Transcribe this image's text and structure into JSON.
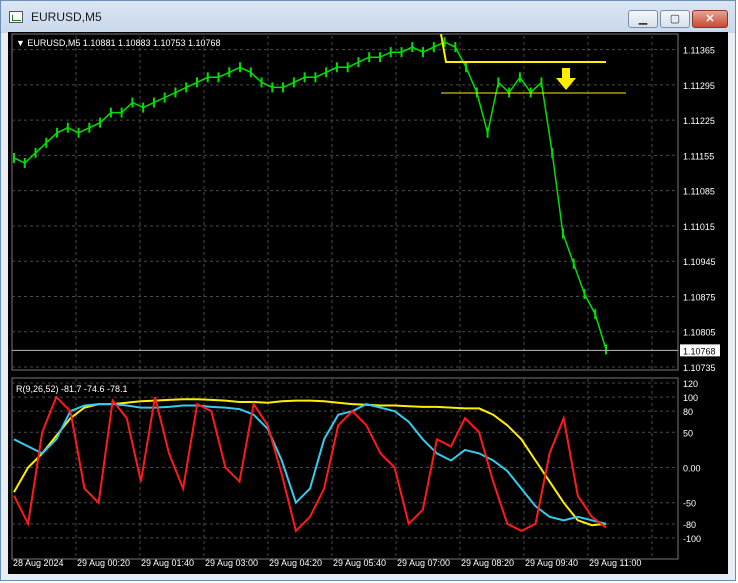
{
  "window": {
    "title": "EURUSD,M5",
    "min_glyph": "▁",
    "max_glyph": "▢",
    "close_glyph": "✕"
  },
  "header": {
    "symbol": "EURUSD,M5",
    "ohlc": "1.10881 1.10883 1.10753 1.10768"
  },
  "price_scale": {
    "labels": [
      "1.11365",
      "1.11295",
      "1.11225",
      "1.11155",
      "1.11085",
      "1.11015",
      "1.10945",
      "1.10875",
      "1.10805",
      "1.10735"
    ],
    "current": "1.10768"
  },
  "indicator": {
    "label": "R(9,26,52) -81.7 -74.6 -78.1",
    "labels": [
      "120",
      "100",
      "80",
      "50",
      "0.00",
      "-50",
      "-80",
      "-100"
    ]
  },
  "time_axis": {
    "labels": [
      "28 Aug 2024",
      "29 Aug 00:20",
      "29 Aug 01:40",
      "29 Aug 03:00",
      "29 Aug 04:20",
      "29 Aug 05:40",
      "29 Aug 07:00",
      "29 Aug 08:20",
      "29 Aug 09:40",
      "29 Aug 11:00"
    ]
  },
  "colors": {
    "bg": "#000000",
    "grid": "#4a4a4a",
    "candle": "#00e000",
    "yellow": "#ffee00",
    "red": "#ff1a1a",
    "cyan": "#33ccee",
    "text": "#ffffff"
  },
  "chart_data": {
    "type": "line",
    "price": {
      "ylim": [
        1.10735,
        1.114
      ],
      "series": [
        {
          "values": [
            1.1115,
            1.1114,
            1.1116,
            1.1118,
            1.112,
            1.1121,
            1.112,
            1.1121,
            1.1122,
            1.1124,
            1.1124,
            1.1126,
            1.1125,
            1.1126,
            1.1127,
            1.1128,
            1.1129,
            1.113,
            1.1131,
            1.1131,
            1.1132,
            1.1133,
            1.1132,
            1.113,
            1.1129,
            1.1129,
            1.113,
            1.1131,
            1.1131,
            1.1132,
            1.1133,
            1.1133,
            1.1134,
            1.1135,
            1.1135,
            1.1136,
            1.1136,
            1.1137,
            1.1136,
            1.1137,
            1.1138,
            1.1137,
            1.1133,
            1.1128,
            1.112,
            1.113,
            1.1128,
            1.1131,
            1.1128,
            1.113,
            1.1116,
            1.11,
            1.1094,
            1.1088,
            1.1084,
            1.1077
          ]
        }
      ]
    },
    "indicator": {
      "ylim": [
        -120,
        120
      ],
      "series": [
        {
          "values": [
            -35,
            0,
            20,
            45,
            70,
            85,
            90,
            90,
            92,
            94,
            95,
            96,
            97,
            97,
            96,
            95,
            93,
            93,
            92,
            94,
            95,
            95,
            94,
            92,
            90,
            89,
            88,
            88,
            87,
            86,
            86,
            85,
            84,
            84,
            75,
            60,
            40,
            10,
            -20,
            -50,
            -75,
            -82,
            -80
          ]
        },
        {
          "values": [
            40,
            30,
            20,
            40,
            80,
            88,
            90,
            90,
            88,
            85,
            85,
            86,
            88,
            88,
            86,
            85,
            83,
            75,
            55,
            10,
            -50,
            -30,
            40,
            75,
            80,
            90,
            85,
            80,
            65,
            40,
            20,
            10,
            25,
            20,
            10,
            -5,
            -30,
            -55,
            -70,
            -75,
            -70,
            -75,
            -80
          ]
        },
        {
          "values": [
            -40,
            -80,
            50,
            100,
            80,
            -30,
            -50,
            95,
            70,
            -20,
            100,
            20,
            -30,
            90,
            80,
            0,
            -20,
            90,
            60,
            -10,
            -90,
            -70,
            -30,
            60,
            80,
            60,
            20,
            0,
            -80,
            -60,
            40,
            30,
            70,
            50,
            -20,
            -80,
            -90,
            -80,
            20,
            70,
            -40,
            -70,
            -85
          ]
        }
      ]
    }
  }
}
